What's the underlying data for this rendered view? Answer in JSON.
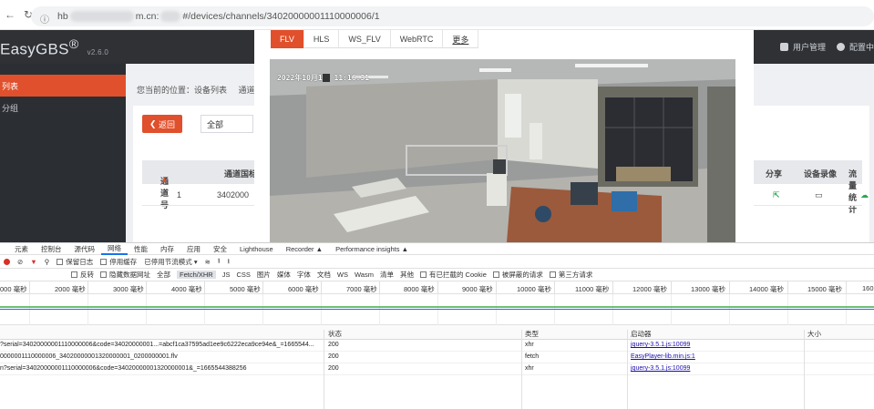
{
  "browser": {
    "url_prefix": "hb",
    "url_mid": "m.cn:",
    "url_path": "#/devices/channels/34020000001110000006/1"
  },
  "app": {
    "logo": "EasyGBS",
    "logo_reg": "®",
    "version": "v2.6.0",
    "user_menu": "用户管理",
    "config_menu": "配置中"
  },
  "sidebar": {
    "items": [
      {
        "label": "列表"
      },
      {
        "label": "分组"
      }
    ]
  },
  "main": {
    "breadcrumb": "您当前的位置：设备列表",
    "breadcrumb_tail": "通道",
    "back_label": "返回",
    "filter_value": "全部",
    "table": {
      "headers": [
        "通道号",
        "通道国标",
        "分享",
        "设备录像",
        "流量统计"
      ],
      "row": {
        "index": "1",
        "code": "3402000"
      }
    }
  },
  "player": {
    "tabs": [
      "FLV",
      "HLS",
      "WS_FLV",
      "WebRTC",
      "更多"
    ],
    "osd_date": "2022年10月1",
    "osd_time": "11:16:31"
  },
  "devtools": {
    "tabs": [
      "元素",
      "控制台",
      "源代码",
      "网络",
      "性能",
      "内存",
      "应用",
      "安全",
      "Lighthouse",
      "Recorder ▲",
      "Performance insights ▲"
    ],
    "active_tab": "网络",
    "toolbar": {
      "preserve_log": "保留日志",
      "disable_cache": "停用缓存",
      "throttle": "已停用节流模式"
    },
    "filters": [
      "反转",
      "隐藏数据网址",
      "全部",
      "Fetch/XHR",
      "JS",
      "CSS",
      "图片",
      "媒体",
      "字体",
      "文档",
      "WS",
      "Wasm",
      "清单",
      "其他",
      "有已拦截的 Cookie",
      "被屏蔽的请求",
      "第三方请求"
    ],
    "ruler": [
      "000 毫秒",
      "2000 毫秒",
      "3000 毫秒",
      "4000 毫秒",
      "5000 毫秒",
      "6000 毫秒",
      "7000 毫秒",
      "8000 毫秒",
      "9000 毫秒",
      "10000 毫秒",
      "11000 毫秒",
      "12000 毫秒",
      "13000 毫秒",
      "14000 毫秒",
      "15000 毫秒",
      "160"
    ],
    "columns": {
      "status": "状态",
      "type": "类型",
      "initiator": "启动器",
      "size": "大小"
    },
    "requests": [
      {
        "name": "?serial=34020000001110000006&code=34020000001...=abcf1ca37595ad1ee9c6222eca9ce94e&_=1665544...",
        "status": "200",
        "type": "xhr",
        "initiator": "jquery-3.5.1.js:10099"
      },
      {
        "name": "0000001110000006_34020000001320000001_0200000001.flv",
        "status": "200",
        "type": "fetch",
        "initiator": "EasyPlayer-lib.min.js:1"
      },
      {
        "name": "n?serial=34020000001110000006&code=34020000001320000001&_=1665544388256",
        "status": "200",
        "type": "xhr",
        "initiator": "jquery-3.5.1.js:10099"
      }
    ]
  }
}
